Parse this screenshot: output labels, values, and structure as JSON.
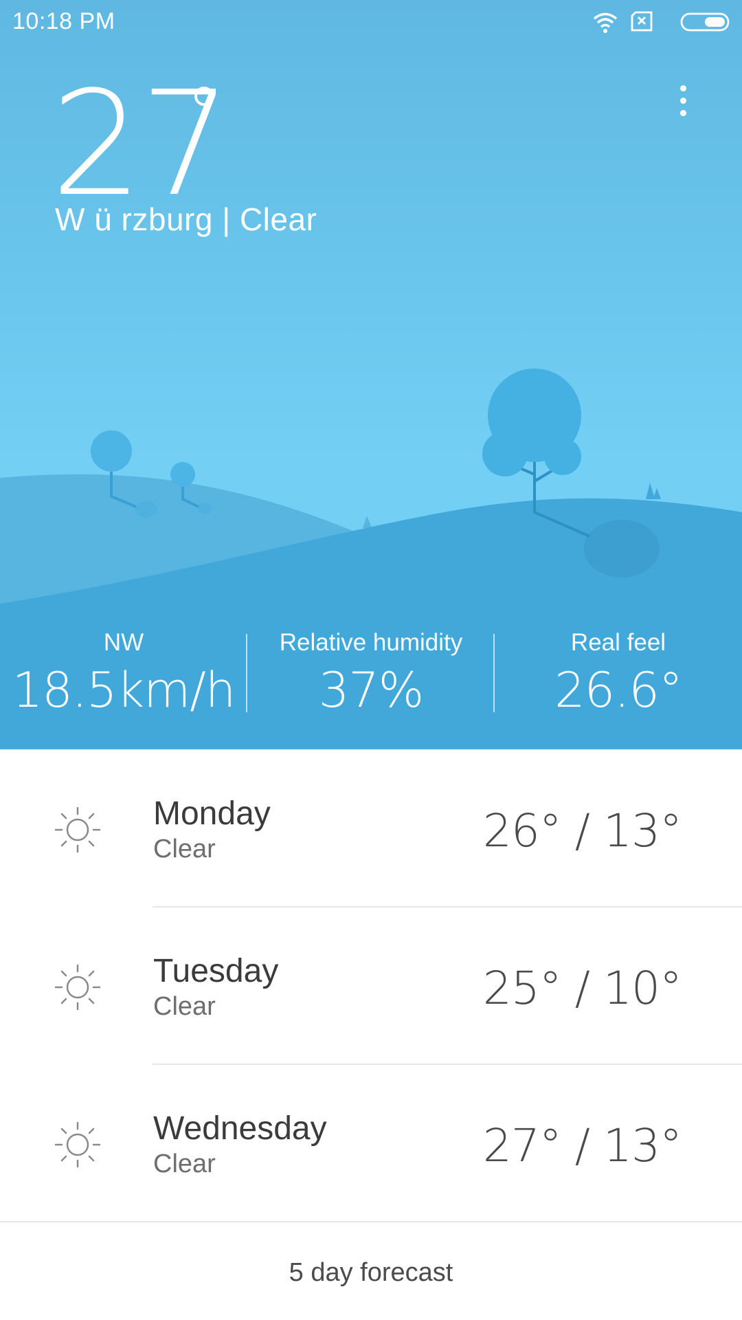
{
  "status_bar": {
    "time": "10:18  PM",
    "icons": [
      "wifi-icon",
      "sim-card-icon",
      "battery-icon"
    ]
  },
  "current": {
    "temperature": "27",
    "location_line": "W ü rzburg | Clear"
  },
  "stats": [
    {
      "label": "NW",
      "value": "18.5km/h"
    },
    {
      "label": "Relative humidity",
      "value": "37%"
    },
    {
      "label": "Real feel",
      "value": "26.6°"
    }
  ],
  "forecast": [
    {
      "day": "Monday",
      "condition": "Clear",
      "range": "26° / 13°",
      "icon": "sun-icon"
    },
    {
      "day": "Tuesday",
      "condition": "Clear",
      "range": "25° / 10°",
      "icon": "sun-icon"
    },
    {
      "day": "Wednesday",
      "condition": "Clear",
      "range": "27° / 13°",
      "icon": "sun-icon"
    }
  ],
  "footer": {
    "label": "5 day forecast"
  },
  "colors": {
    "sky_top": "#5fb8e1",
    "sky_bottom": "#74cff5",
    "stats_band": "#42a8da",
    "text_dark": "#3b3b3b",
    "text_muted": "#6e6e6e"
  }
}
